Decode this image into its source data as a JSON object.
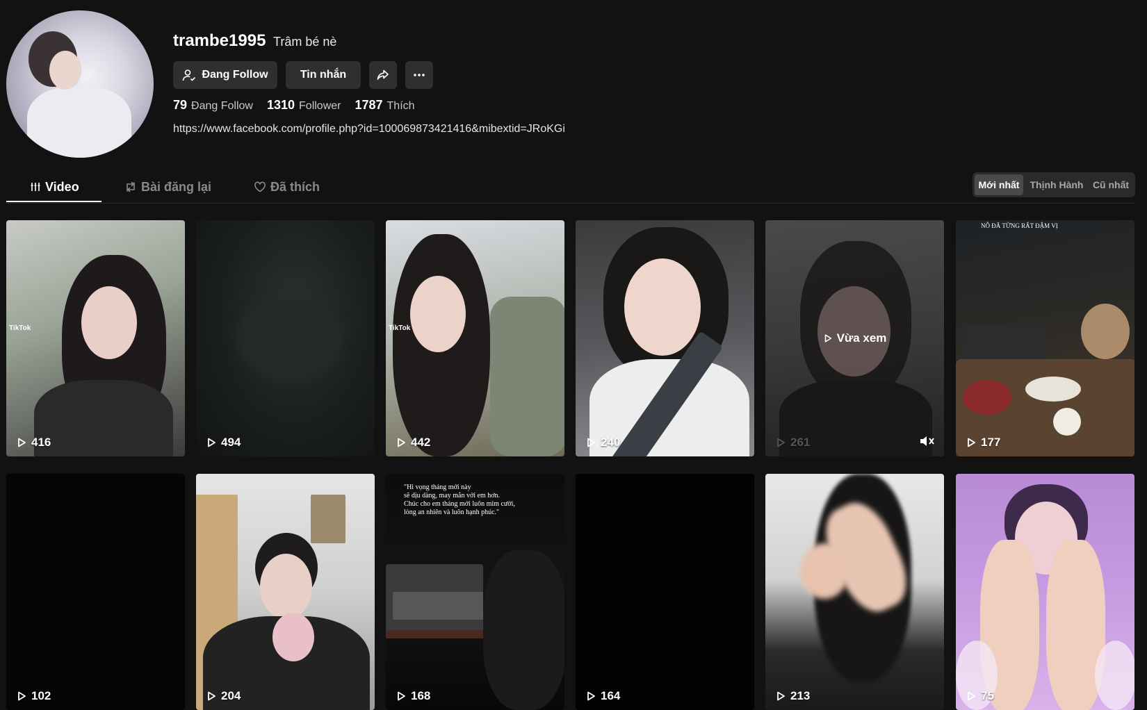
{
  "profile": {
    "username": "trambe1995",
    "nickname": "Trâm bé nè",
    "bio_link": "https://www.facebook.com/profile.php?id=100069873421416&mibextid=JRoKGi",
    "stats": {
      "following_count": "79",
      "following_label": "Đang Follow",
      "followers_count": "1310",
      "followers_label": "Follower",
      "likes_count": "1787",
      "likes_label": "Thích"
    }
  },
  "actions": {
    "follow_label": "Đang Follow",
    "message_label": "Tin nhắn"
  },
  "tabs": [
    {
      "label": "Video"
    },
    {
      "label": "Bài đăng lại"
    },
    {
      "label": "Đã thích"
    }
  ],
  "sort": [
    {
      "label": "Mới nhất"
    },
    {
      "label": "Thịnh Hành"
    },
    {
      "label": "Cũ nhất"
    }
  ],
  "videos": [
    {
      "views": "416",
      "watermark": "TikTok"
    },
    {
      "views": "494"
    },
    {
      "views": "442",
      "watermark": "TikTok"
    },
    {
      "views": "240"
    },
    {
      "views": "261",
      "status": "Vừa xem"
    },
    {
      "views": "177",
      "overlay": "NỖ ĐÃ TỪNG RẤT ĐẬM VỊ"
    },
    {
      "views": "102"
    },
    {
      "views": "204"
    },
    {
      "views": "168",
      "overlay_lines": [
        "\"Hi vọng tháng mới này",
        "sẽ dịu dàng, may mắn với em hơn.",
        "Chúc cho em tháng mới luôn mỉm cười,",
        "lòng an nhiên và luôn hạnh phúc.\""
      ]
    },
    {
      "views": "164"
    },
    {
      "views": "213"
    },
    {
      "views": "75"
    }
  ],
  "colors": {
    "background": "#121212",
    "button": "#2f2f2f",
    "muted_text": "#8a8a8a"
  }
}
